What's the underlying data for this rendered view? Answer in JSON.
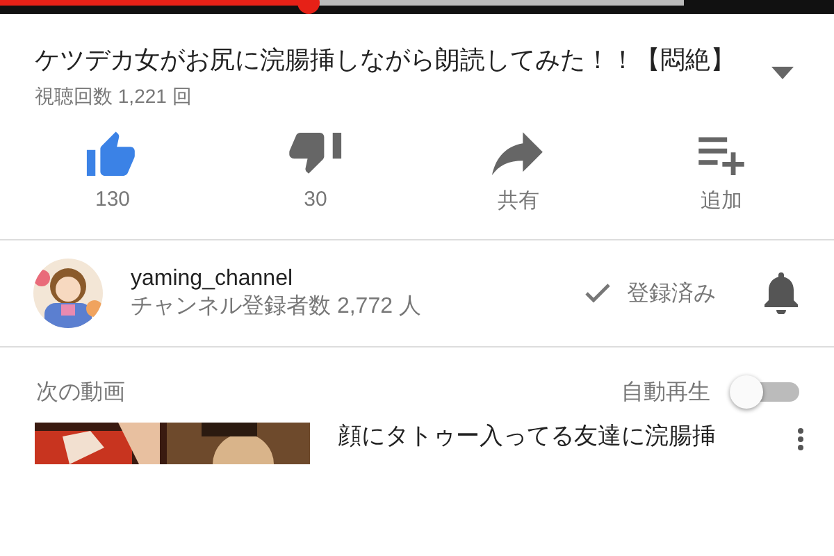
{
  "player": {
    "level": 0.37
  },
  "video": {
    "title": "ケツデカ女がお尻に浣腸挿しながら朗読してみた！！【悶絶】",
    "views": "視聴回数 1,221 回"
  },
  "actions": [
    {
      "kind": "like",
      "label": "130",
      "selected": true
    },
    {
      "kind": "dislike",
      "label": "30",
      "selected": false
    },
    {
      "kind": "share",
      "label": "共有"
    },
    {
      "kind": "add",
      "label": "追加"
    }
  ],
  "channel": {
    "name": "yaming_channel",
    "subscribers": "チャンネル登録者数 2,772 人",
    "subscribe_label": "登録済み",
    "subscribed": true
  },
  "up_next": {
    "heading": "次の動画",
    "autoplay_label": "自動再生",
    "autoplay_on": false,
    "items": [
      {
        "title": "顔にタトゥー入ってる友達に浣腸挿"
      }
    ]
  }
}
